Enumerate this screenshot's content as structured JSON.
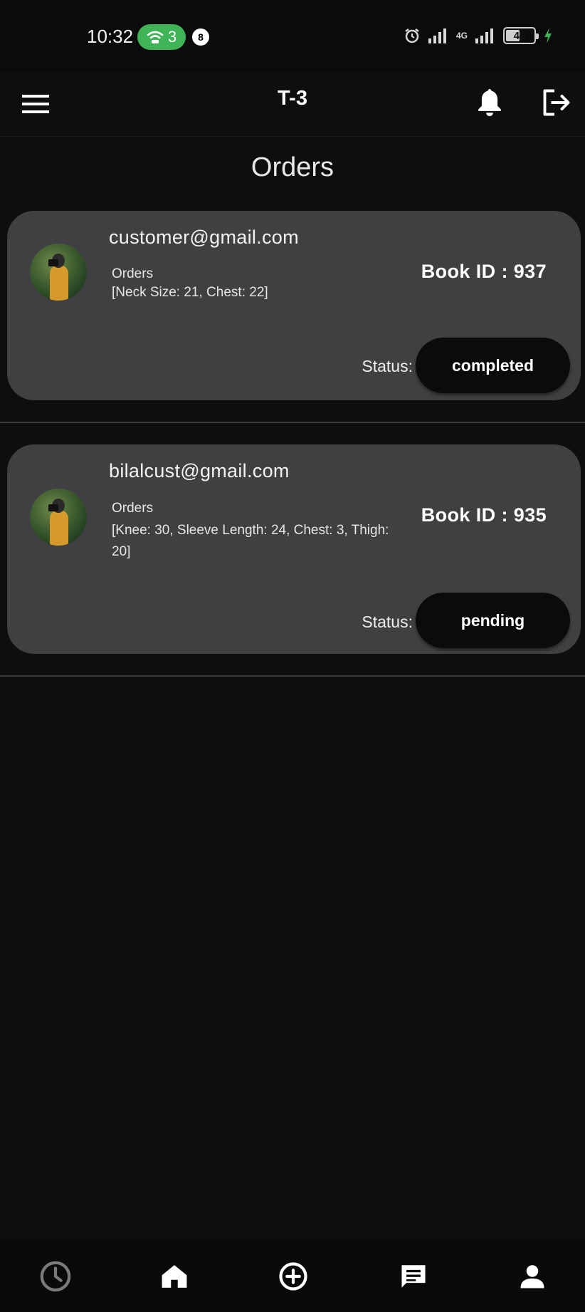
{
  "status_bar": {
    "time": "10:32",
    "wifi_count": "3",
    "notification_count": "8",
    "network": "4G",
    "battery": "49",
    "battery_level_percent": 49
  },
  "app_bar": {
    "title": "T-3",
    "icons": [
      "menu-icon",
      "bell-icon",
      "logout-icon"
    ]
  },
  "page": {
    "title": "Orders"
  },
  "orders": [
    {
      "email": "customer@gmail.com",
      "orders_label": "Orders",
      "details": "[Neck Size: 21, Chest: 22]",
      "book_id": "Book ID : 937",
      "status_label": "Status:",
      "status": "completed"
    },
    {
      "email": "bilalcust@gmail.com",
      "orders_label": "Orders",
      "details": "[Knee: 30, Sleeve Length: 24, Chest: 3, Thigh: 20]",
      "book_id": "Book ID : 935",
      "status_label": "Status:",
      "status": "pending"
    }
  ],
  "bottom_nav": {
    "items": [
      "history-icon",
      "home-icon",
      "add-circle-icon",
      "chat-icon",
      "profile-icon"
    ]
  },
  "colors": {
    "background": "#0e0e0f",
    "card": "#404042",
    "pill": "#0b0b0d",
    "wifi_pill": "#3fb457",
    "history_icon": "#7a7a7a"
  }
}
